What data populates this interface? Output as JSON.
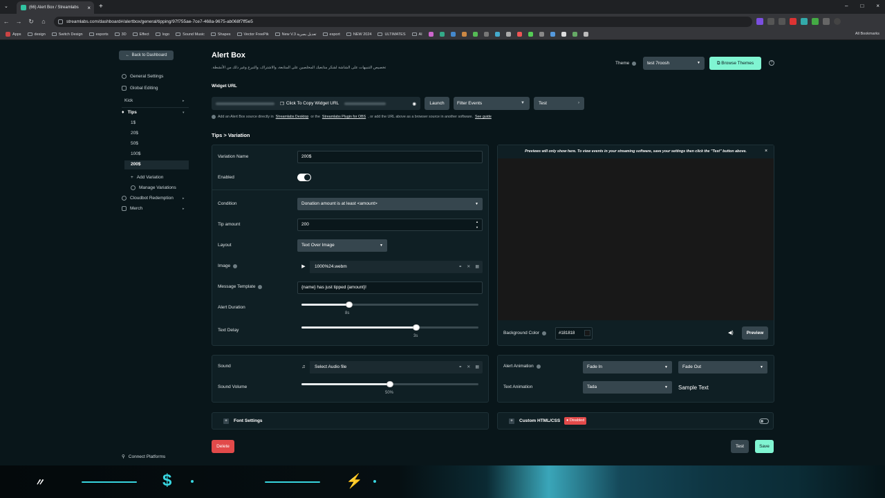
{
  "browser": {
    "tab_title": "(66) Alert Box / Streamlabs",
    "url": "streamlabs.com/dashboard#/alertbox/general/tipping/97f755ae-7ce7-468a-9675-ab068f7ff5e5",
    "bookmarks": [
      "Apps",
      "design",
      "Switch Design",
      "esports",
      "3D",
      "Effect",
      "logo",
      "Sound Music",
      "Shapes",
      "Vector FreePik",
      "New V.3 تعديل بصرية",
      "esport",
      "NEW 2024",
      "ULTIMATES",
      "AI"
    ],
    "all_bookmarks": "All Bookmarks"
  },
  "sidebar": {
    "back_label": "Back to Dashboard",
    "items": [
      {
        "label": "General Settings"
      },
      {
        "label": "Global Editing"
      },
      {
        "label": "Kick"
      },
      {
        "label": "Tips"
      }
    ],
    "tip_variations": [
      "1$",
      "20$",
      "50$",
      "100$",
      "200$"
    ],
    "add_variation": "Add Variation",
    "manage_variations": "Manage Variations",
    "cloudbot": "Cloudbot Redemption",
    "merch": "Merch",
    "connect_platforms": "Connect Platforms"
  },
  "header": {
    "title": "Alert Box",
    "description": "تخصيص التنبيهات على الشاشة لشكر متابعيك المخلصين على المتابعة، والاشتراك، والتبرع وغير ذلك من الأنشطة.",
    "theme_label": "Theme",
    "theme_value": "test 7roosh",
    "browse_label": "Browse Themes"
  },
  "widget": {
    "label": "Widget URL",
    "copy_label": "Click To Copy Widget URL",
    "launch": "Launch",
    "filter": "Filter Events",
    "test": "Test",
    "hint_pre": "Add an Alert Box source directly in",
    "hint_link1": "Streamlabs Desktop",
    "hint_mid": "or the",
    "hint_link2": "Streamlabs Plugin for OBS",
    "hint_post": ", or add the URL above as a browser source in another software.",
    "hint_guide": "See guide"
  },
  "breadcrumb": "Tips > Variation",
  "form": {
    "variation_name_label": "Variation Name",
    "variation_name": "200$",
    "enabled_label": "Enabled",
    "condition_label": "Condition",
    "condition_value": "Donation amount is at least <amount>",
    "tip_amount_label": "Tip amount",
    "tip_amount": "200",
    "layout_label": "Layout",
    "layout_value": "Text Over Image",
    "image_label": "Image",
    "image_file": "1000%24.webm",
    "message_label": "Message Template",
    "message_value": "{name} has just tipped {amount}!",
    "duration_label": "Alert Duration",
    "duration_value": "8s",
    "duration_fraction": 0.27,
    "delay_label": "Text Delay",
    "delay_value": "3s",
    "delay_fraction": 0.65,
    "sound_label": "Sound",
    "sound_file": "Select Audio file",
    "volume_label": "Sound Volume",
    "volume_value": "50%",
    "volume_fraction": 0.5
  },
  "preview": {
    "note": "Previews will only show here. To view events in your streaming software, save your settings then click the \"Test\" button above.",
    "bg_label": "Background Color",
    "bg_value": "#181818",
    "preview_btn": "Preview"
  },
  "animation": {
    "alert_label": "Alert Animation",
    "in_value": "Fade In",
    "out_value": "Fade Out",
    "text_label": "Text Animation",
    "text_value": "Tada",
    "sample": "Sample Text"
  },
  "font_settings": "Font Settings",
  "custom_css": {
    "label": "Custom HTML/CSS",
    "badge": "Disabled"
  },
  "actions": {
    "delete": "Delete",
    "test": "Test",
    "save": "Save"
  },
  "colors": {
    "accent": "#80f5d2",
    "danger": "#e24a4a",
    "bg": "#09161a",
    "panel": "#0f1f24"
  }
}
